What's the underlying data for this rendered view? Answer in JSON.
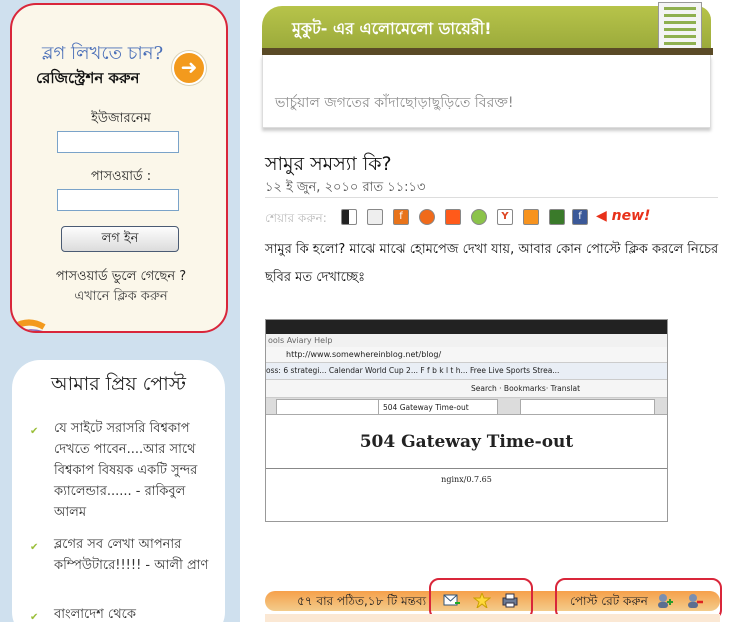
{
  "login": {
    "title": "ব্লগ লিখতে চান?",
    "register_label": "রেজিস্ট্রেশন করুন",
    "username_label": "ইউজারনেম",
    "password_label": "পাসওয়ার্ড :",
    "login_button": "লগ ইন",
    "forgot_line1": "পাসওয়ার্ড ভুলে গেছেন ?",
    "forgot_line2": "এখানে ক্লিক করুন"
  },
  "favorites": {
    "title": "আমার প্রিয় পোস্ট",
    "items": [
      "যে সাইটে সরাসরি বিশ্বকাপ দেখতে পাবেন....আর সাথে বিশ্বকাপ বিষয়ক একটি সুন্দর ক্যালেন্ডার...... - রাকিবুল আলম",
      "ব্লগের সব লেখা আপনার কম্পিউটারে!!!!! - আলী প্রাণ",
      "বাংলাদেশ থেকে"
    ]
  },
  "blog": {
    "banner_title": "মুকুট- এর এলোমেলো ডায়েরী!",
    "tagline": "ভার্চুয়াল জগতের কাঁদাছোড়াছুড়িতে বিরক্ত!"
  },
  "post": {
    "title": "সামুর সমস্যা কি?",
    "date": "১২ ই জুন, ২০১০ রাত ১১:১৩",
    "share_label": "শেয়ার করুন:",
    "new_badge": "◀ new!",
    "body": "সামুর কি হলো? মাঝে মাঝে হোমপেজ দেখা যায়, আবার কোন পোস্টে ক্লিক করলে নিচের ছবির মত দেখাচ্ছেঃ",
    "stats": "৫৭ বার পঠিত,১৮ টি মন্তব্য",
    "rate_label": "পোস্ট রেট করুন"
  },
  "screenshot": {
    "menu": "ools  Aviary  Help",
    "address": "http://www.somewhereinblog.net/blog/",
    "bookmarks": "oss: 6 strategi...  Calendar World Cup 2...  F  f  b  k  l  t  h...  Free Live Sports Strea...",
    "toolbar": "Search  ·  Bookmarks·  Translat",
    "tab_active": "504 Gateway Time-out",
    "error_title": "504 Gateway Time-out",
    "server": "nginx/0.7.65"
  },
  "colors": {
    "accent_red": "#d9263a",
    "banner_green": "#a8b53f",
    "bar_orange": "#f6a04a"
  }
}
